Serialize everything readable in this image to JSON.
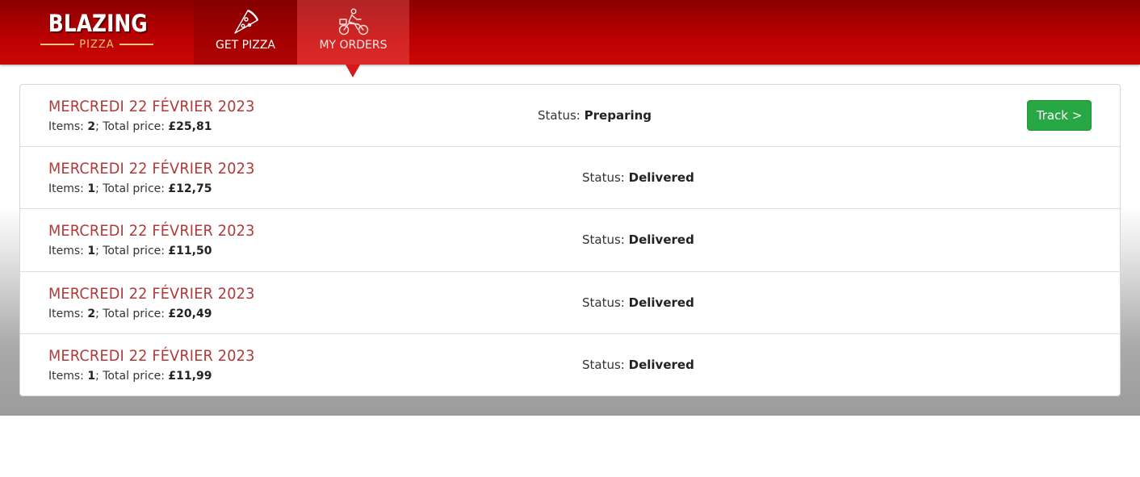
{
  "brand": {
    "name": "BLAZING",
    "sub": "PIZZA"
  },
  "nav": {
    "tabs": [
      {
        "label": "GET PIZZA",
        "icon": "pizza-slice-icon",
        "active": false
      },
      {
        "label": "MY ORDERS",
        "icon": "delivery-bike-icon",
        "active": true
      }
    ]
  },
  "colors": {
    "header": "#b80000",
    "date_text": "#b03a3a",
    "track_button": "#28a745"
  },
  "orders": [
    {
      "date": "MERCREDI 22 FÉVRIER 2023",
      "items_label": "Items:",
      "items": "2",
      "total_label": "; Total price:",
      "total": "£25,81",
      "status_label": "Status:",
      "status": "Preparing",
      "track_label": "Track >"
    },
    {
      "date": "MERCREDI 22 FÉVRIER 2023",
      "items_label": "Items:",
      "items": "1",
      "total_label": "; Total price:",
      "total": "£12,75",
      "status_label": "Status:",
      "status": "Delivered"
    },
    {
      "date": "MERCREDI 22 FÉVRIER 2023",
      "items_label": "Items:",
      "items": "1",
      "total_label": "; Total price:",
      "total": "£11,50",
      "status_label": "Status:",
      "status": "Delivered"
    },
    {
      "date": "MERCREDI 22 FÉVRIER 2023",
      "items_label": "Items:",
      "items": "2",
      "total_label": "; Total price:",
      "total": "£20,49",
      "status_label": "Status:",
      "status": "Delivered"
    },
    {
      "date": "MERCREDI 22 FÉVRIER 2023",
      "items_label": "Items:",
      "items": "1",
      "total_label": "; Total price:",
      "total": "£11,99",
      "status_label": "Status:",
      "status": "Delivered"
    }
  ]
}
